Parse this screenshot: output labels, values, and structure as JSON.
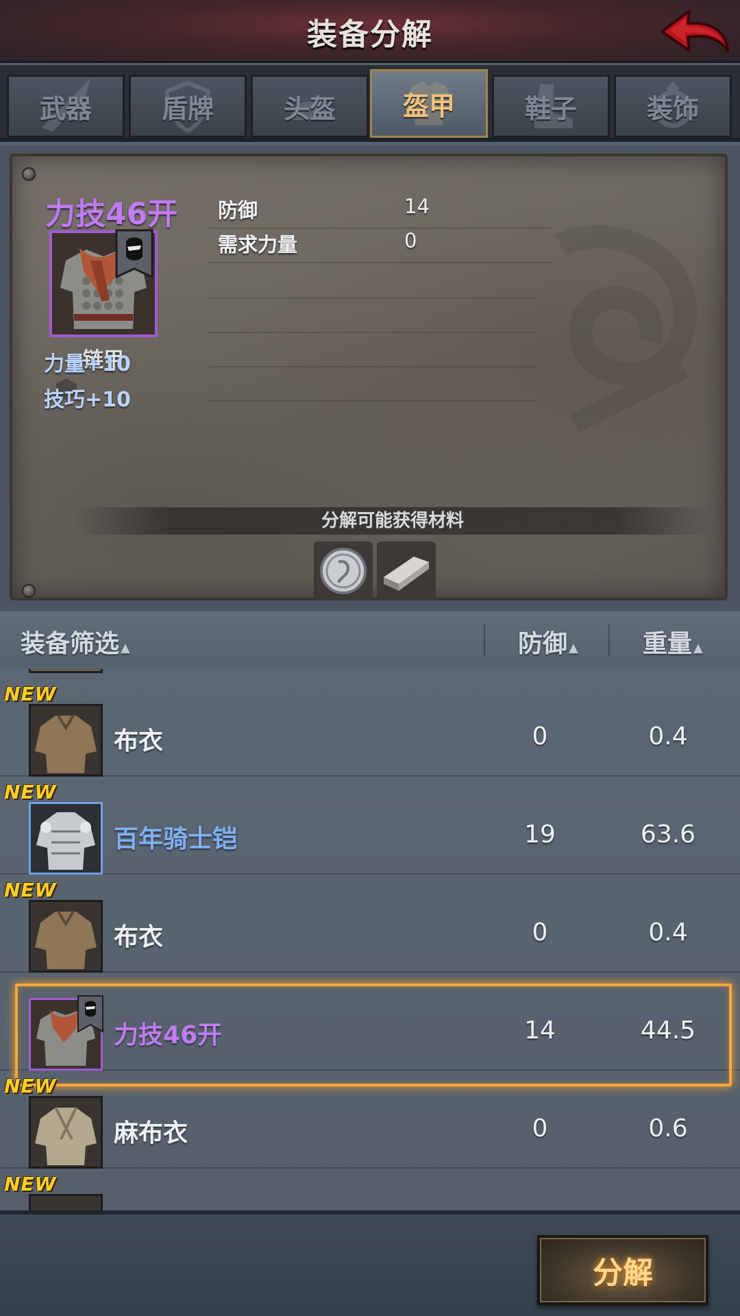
{
  "header": {
    "title": "装备分解"
  },
  "tabs": [
    {
      "label": "武器",
      "active": false
    },
    {
      "label": "盾牌",
      "active": false
    },
    {
      "label": "头盔",
      "active": false
    },
    {
      "label": "盔甲",
      "active": true
    },
    {
      "label": "鞋子",
      "active": false
    },
    {
      "label": "装饰",
      "active": false
    }
  ],
  "detail": {
    "name": "力技46开",
    "type": "链甲",
    "stats": [
      {
        "label": "防御",
        "value": "14"
      },
      {
        "label": "需求力量",
        "value": "0"
      }
    ],
    "bonuses": [
      "力量+10",
      "技巧+10"
    ],
    "materials_title": "分解可能获得材料",
    "materials": [
      "silver-coin-icon",
      "iron-ingot-icon"
    ]
  },
  "list_header": {
    "filter_label": "装备筛选",
    "defense_label": "防御",
    "weight_label": "重量"
  },
  "items": [
    {
      "name": "布衣",
      "new": "NEW",
      "defense": "0",
      "weight": "0.4",
      "rarity": "common"
    },
    {
      "name": "百年骑士铠",
      "new": "NEW",
      "defense": "19",
      "weight": "63.6",
      "rarity": "rare"
    },
    {
      "name": "布衣",
      "new": "NEW",
      "defense": "0",
      "weight": "0.4",
      "rarity": "common"
    },
    {
      "name": "力技46开",
      "new": "",
      "defense": "14",
      "weight": "44.5",
      "rarity": "epic",
      "selected": true
    },
    {
      "name": "麻布衣",
      "new": "NEW",
      "defense": "0",
      "weight": "0.6",
      "rarity": "common"
    },
    {
      "name": "",
      "new": "NEW",
      "defense": "",
      "weight": "",
      "rarity": "common"
    }
  ],
  "footer": {
    "decompose_label": "分解"
  },
  "colors": {
    "epic": "#c07cf0",
    "rare": "#7fb0f3",
    "new_badge": "#ffcf2a",
    "selection": "#f5a93a",
    "bonus": "#b8d4ff"
  }
}
